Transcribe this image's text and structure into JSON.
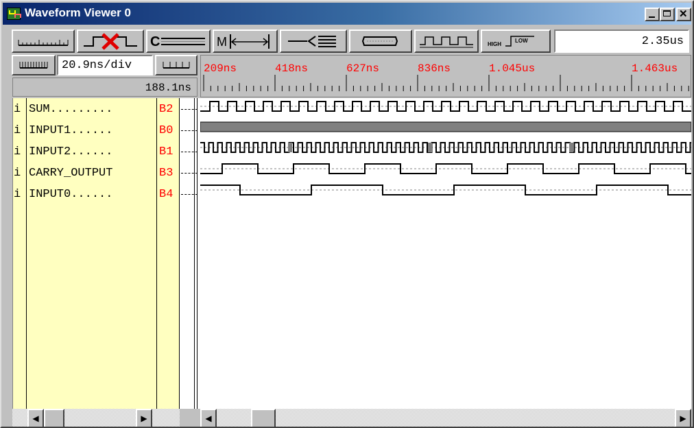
{
  "window": {
    "title": "Waveform Viewer 0"
  },
  "toolbar": {
    "time_value": "2.35us",
    "buttons": [
      "ruler-button",
      "delete-marker-button",
      "cursor-c-button",
      "marker-m-button",
      "signal-list-button",
      "bus-button",
      "clock-button",
      "high-low-button"
    ]
  },
  "scale": {
    "value": "20.9ns/div"
  },
  "cursor": {
    "time": "188.1ns"
  },
  "ruler": {
    "labels": [
      "209ns",
      "418ns",
      "627ns",
      "836ns",
      "1.045us",
      "1.463us"
    ]
  },
  "signals": [
    {
      "i": "i",
      "name": "SUM.........",
      "ref": "B2"
    },
    {
      "i": "i",
      "name": "INPUT1......",
      "ref": "B0"
    },
    {
      "i": "i",
      "name": "INPUT2......",
      "ref": "B1"
    },
    {
      "i": "i",
      "name": "CARRY_OUTPUT",
      "ref": "B3"
    },
    {
      "i": "i",
      "name": "INPUT0......",
      "ref": "B4"
    }
  ],
  "colors": {
    "ref_label": "#ff0000",
    "ruler_label": "#ff0000",
    "name_pane": "#ffffc0",
    "bus_fill": "#808080"
  }
}
